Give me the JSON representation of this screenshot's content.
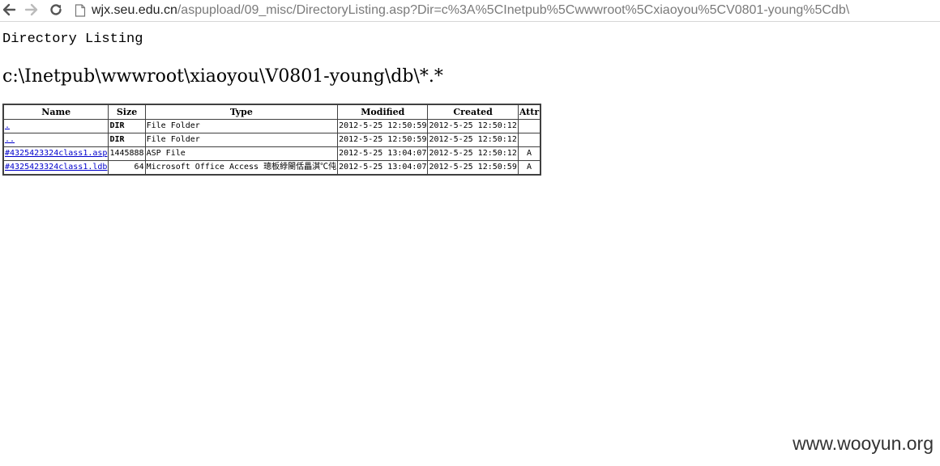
{
  "browser": {
    "url_host": "wjx.seu.edu.cn",
    "url_path": "/aspupload/09_misc/DirectoryListing.asp?Dir=c%3A%5CInetpub%5Cwwwroot%5Cxiaoyou%5CV0801-young%5Cdb\\"
  },
  "page": {
    "heading": "Directory Listing",
    "path": "c:\\Inetpub\\wwwroot\\xiaoyou\\V0801-young\\db\\*.*"
  },
  "table": {
    "headers": {
      "name": "Name",
      "size": "Size",
      "type": "Type",
      "modified": "Modified",
      "created": "Created",
      "attr": "Attr"
    },
    "rows": [
      {
        "name": ".",
        "size": "DIR",
        "type": "File Folder",
        "modified": "2012-5-25 12:50:59",
        "created": "2012-5-25 12:50:12",
        "attr": ""
      },
      {
        "name": "..",
        "size": "DIR",
        "type": "File Folder",
        "modified": "2012-5-25 12:50:59",
        "created": "2012-5-25 12:50:12",
        "attr": ""
      },
      {
        "name": "#4325423324class1.asp",
        "size": "1445888",
        "type": "ASP File",
        "modified": "2012-5-25 13:04:07",
        "created": "2012-5-25 12:50:12",
        "attr": "A"
      },
      {
        "name": "#4325423324class1.ldb",
        "size": "64",
        "type": "Microsoft Office Access 璁板綍閿佸畾淇℃伅",
        "modified": "2012-5-25 13:04:07",
        "created": "2012-5-25 12:50:59",
        "attr": "A"
      }
    ]
  },
  "watermark": "www.wooyun.org",
  "icons": {
    "back": "back-arrow-icon",
    "forward": "forward-arrow-icon",
    "reload": "reload-icon",
    "page": "page-icon"
  }
}
